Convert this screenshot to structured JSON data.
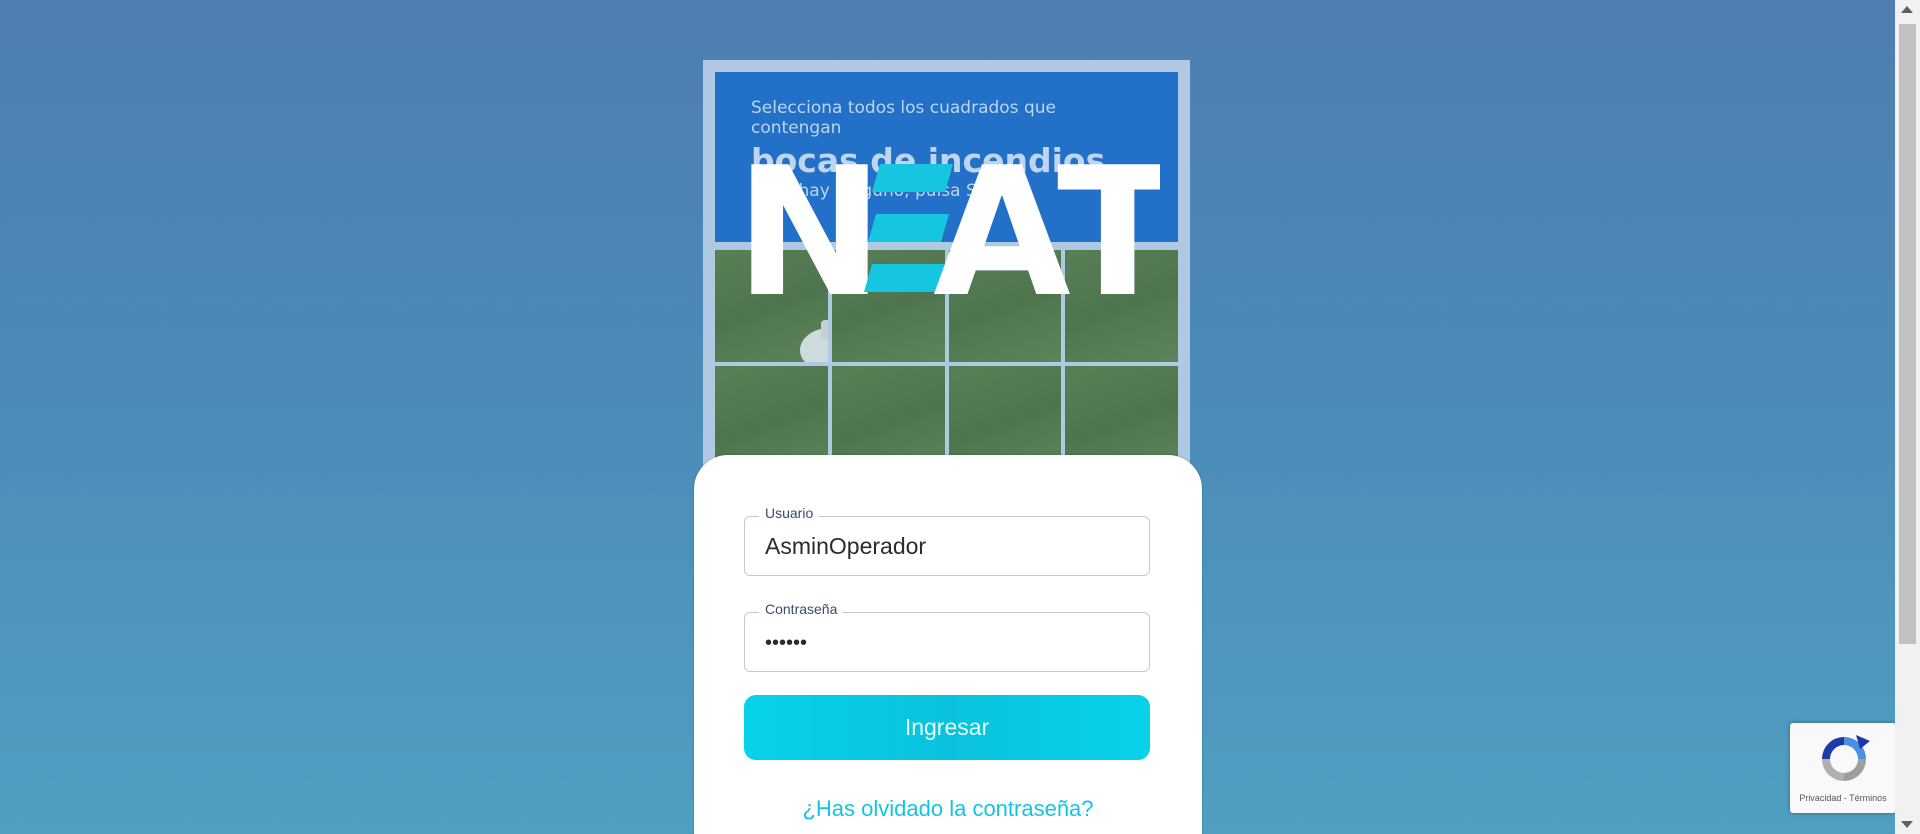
{
  "captcha": {
    "instruction": "Selecciona todos los cuadrados que contengan",
    "target": "bocas de incendios",
    "hint": "Si no hay ninguno, pulsa Saltar"
  },
  "logo": {
    "text_left": "N",
    "text_right": "AT",
    "accent_color": "#16c6e0"
  },
  "form": {
    "username": {
      "label": "Usuario",
      "value": "AsminOperador"
    },
    "password": {
      "label": "Contraseña",
      "value": "••••••"
    },
    "submit_label": "Ingresar",
    "forgot_label": "¿Has olvidado la contraseña?"
  },
  "recaptcha": {
    "terms": "Privacidad - Términos"
  },
  "colors": {
    "button": "#07d2e8",
    "link": "#15c4e0",
    "captcha_header": "#1f6fc9"
  }
}
